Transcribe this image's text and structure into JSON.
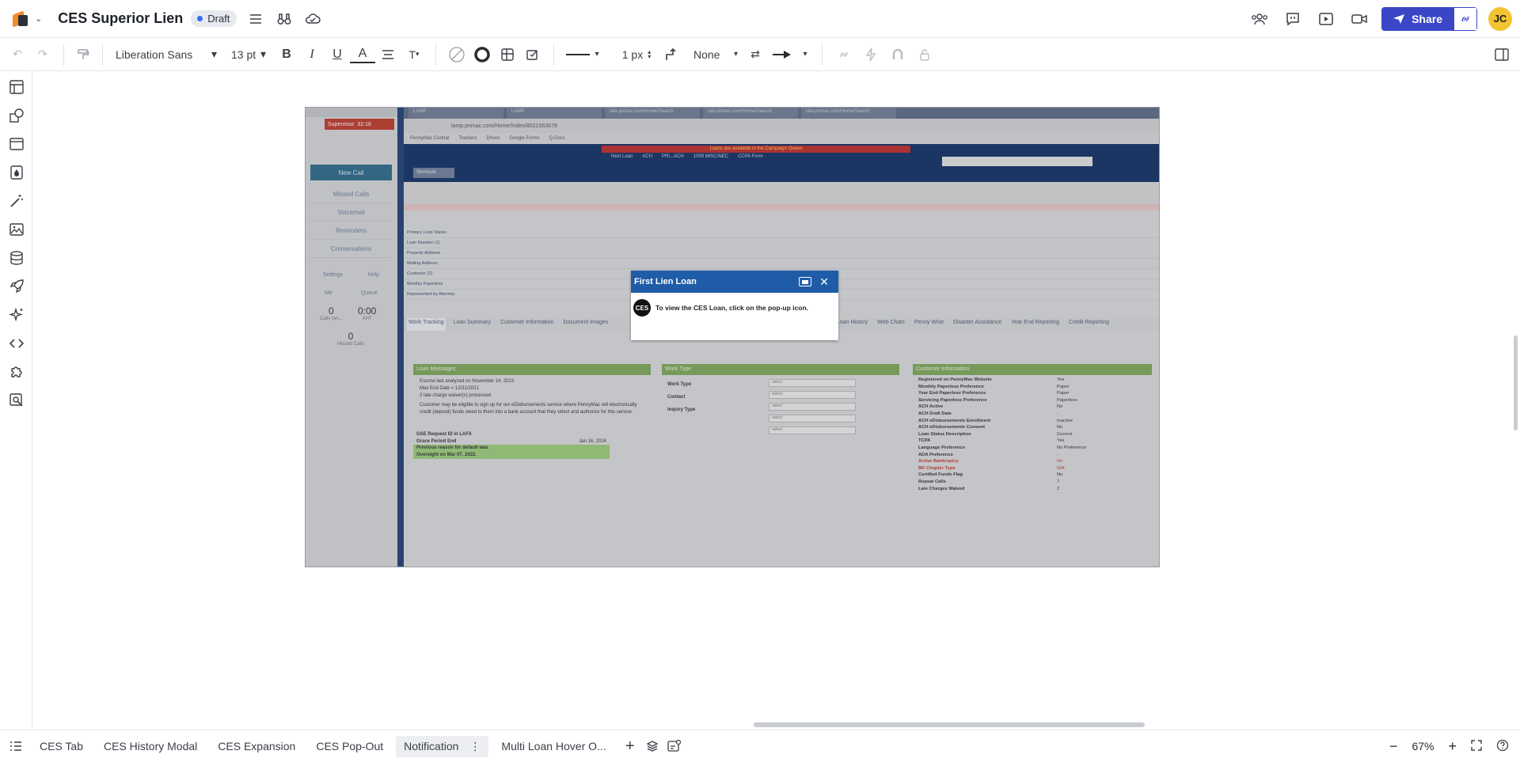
{
  "header": {
    "doc_title": "CES Superior Lien",
    "status": "Draft",
    "share_label": "Share",
    "user_initials": "JC"
  },
  "toolbar": {
    "font_family": "Liberation Sans",
    "font_size": "13 pt",
    "line_width": "1 px",
    "arrow_style": "None"
  },
  "bottom": {
    "tabs": [
      {
        "label": "CES Tab"
      },
      {
        "label": "CES History Modal"
      },
      {
        "label": "CES Expansion"
      },
      {
        "label": "CES Pop-Out"
      },
      {
        "label": "Notification"
      },
      {
        "label": "Multi Loan Hover O..."
      }
    ],
    "zoom": "67%"
  },
  "screenshot": {
    "left_panel": {
      "supervisor": "Supervisor",
      "timer": "32:16",
      "new_call": "New Call",
      "menu": [
        "Missed Calls",
        "Voicemail",
        "Reminders",
        "Conversations"
      ],
      "settings": "Settings",
      "help": "Help",
      "me_label": "Me",
      "queue_label": "Queue",
      "calls_count": "0",
      "calls_label": "Calls (en...",
      "avg": "0:00",
      "avg_label": "AHT",
      "missed_count": "0",
      "missed_label": "Missed Calls"
    },
    "browser": {
      "url": "lamp.pnmac.com/Home/Index/8021563678",
      "bookmarks": [
        "PennyMac Central",
        "Trackers",
        "Drives",
        "Google Forms",
        "Q-Docs"
      ],
      "tabs": [
        "LAMP",
        "LAMP",
        "lafa.pnmac.com/Home/Search",
        "lafa.pnmac.com/Home/Search",
        "lafa.pnmac.com/Home/Search"
      ]
    },
    "app": {
      "campaign_banner": "Loans are available in the Campaign Queue",
      "links": [
        "Next Loan",
        "ACH",
        "PRI...ACH",
        "1099 MISC/NEC",
        "CCPA Form"
      ],
      "shortcuts": "Shortcuts",
      "tabs": [
        "Work Tracking",
        "Loan Summary",
        "Customer Information",
        "Document Images",
        "Prior Loan History",
        "Web Chats",
        "Penny Wise",
        "Disaster Assistance",
        "Year End Reporting",
        "Credit Reporting"
      ],
      "fields": [
        "Primary Loan Status",
        "Loan Number (1)",
        "Property Address",
        "Mailing Address",
        "Customer (2)",
        "Monthly Paperless",
        "Represented by Attorney"
      ],
      "loan_messages_title": "Loan Messages",
      "loan_messages": [
        "Escrow last analyzed on November 14, 2023",
        "Max End Date = 12/31/2021",
        "2 late charge waiver(s) processed",
        "Customer may be eligible to sign up for our eDisbursements service where PennyMac will electronically credit (deposit) funds owed to them into a bank account that they select and authorize for this service."
      ],
      "gse_label": "GSE Request ID in LAFA",
      "grace_label": "Grace Period End",
      "grace_value": "Jan 16, 2024",
      "default_reason": "Previous reason for default was",
      "oversight": "Oversight on Mar 07, 2022.",
      "work_type_title": "Work Type",
      "work_fields": [
        "Work Type",
        "Contact",
        "Inquiry Type"
      ],
      "select_placeholder": "select",
      "customer_info_title": "Customer Information",
      "customer_info": [
        {
          "label": "Registered on PennyMac Website",
          "value": "Yes"
        },
        {
          "label": "Monthly Paperless Preference",
          "value": "Paper"
        },
        {
          "label": "Year End Paperless Preference",
          "value": "Paper"
        },
        {
          "label": "Servicing Paperless Preference",
          "value": "Paperless"
        },
        {
          "label": "ACH Active",
          "value": "No"
        },
        {
          "label": "ACH Draft Date",
          "value": "-"
        },
        {
          "label": "ACH eDisbursements Enrollment",
          "value": "Inactive"
        },
        {
          "label": "ACH eDisbursements Consent",
          "value": "No"
        },
        {
          "label": "Loan Status Description",
          "value": "Current"
        },
        {
          "label": "TCPA",
          "value": "Yes"
        },
        {
          "label": "Language Preference",
          "value": "No Preference"
        },
        {
          "label": "ADA Preference",
          "value": "-"
        },
        {
          "label": "Active Bankruptcy",
          "value": "No"
        },
        {
          "label": "BK Chapter Type",
          "value": "N/A"
        },
        {
          "label": "Certified Funds Flag",
          "value": "No"
        },
        {
          "label": "Repeat Calls",
          "value": "7"
        },
        {
          "label": "Late Charges Waived",
          "value": "2"
        }
      ]
    },
    "modal": {
      "title": "First Lien Loan",
      "logo_text": "CES",
      "message": "To view the CES Loan, click on the pop-up icon."
    }
  },
  "colors": {
    "share_button": "#3b46c7",
    "avatar": "#f3c431",
    "modal_header": "#1f5ca8",
    "draft_dot": "#2f6df6"
  }
}
